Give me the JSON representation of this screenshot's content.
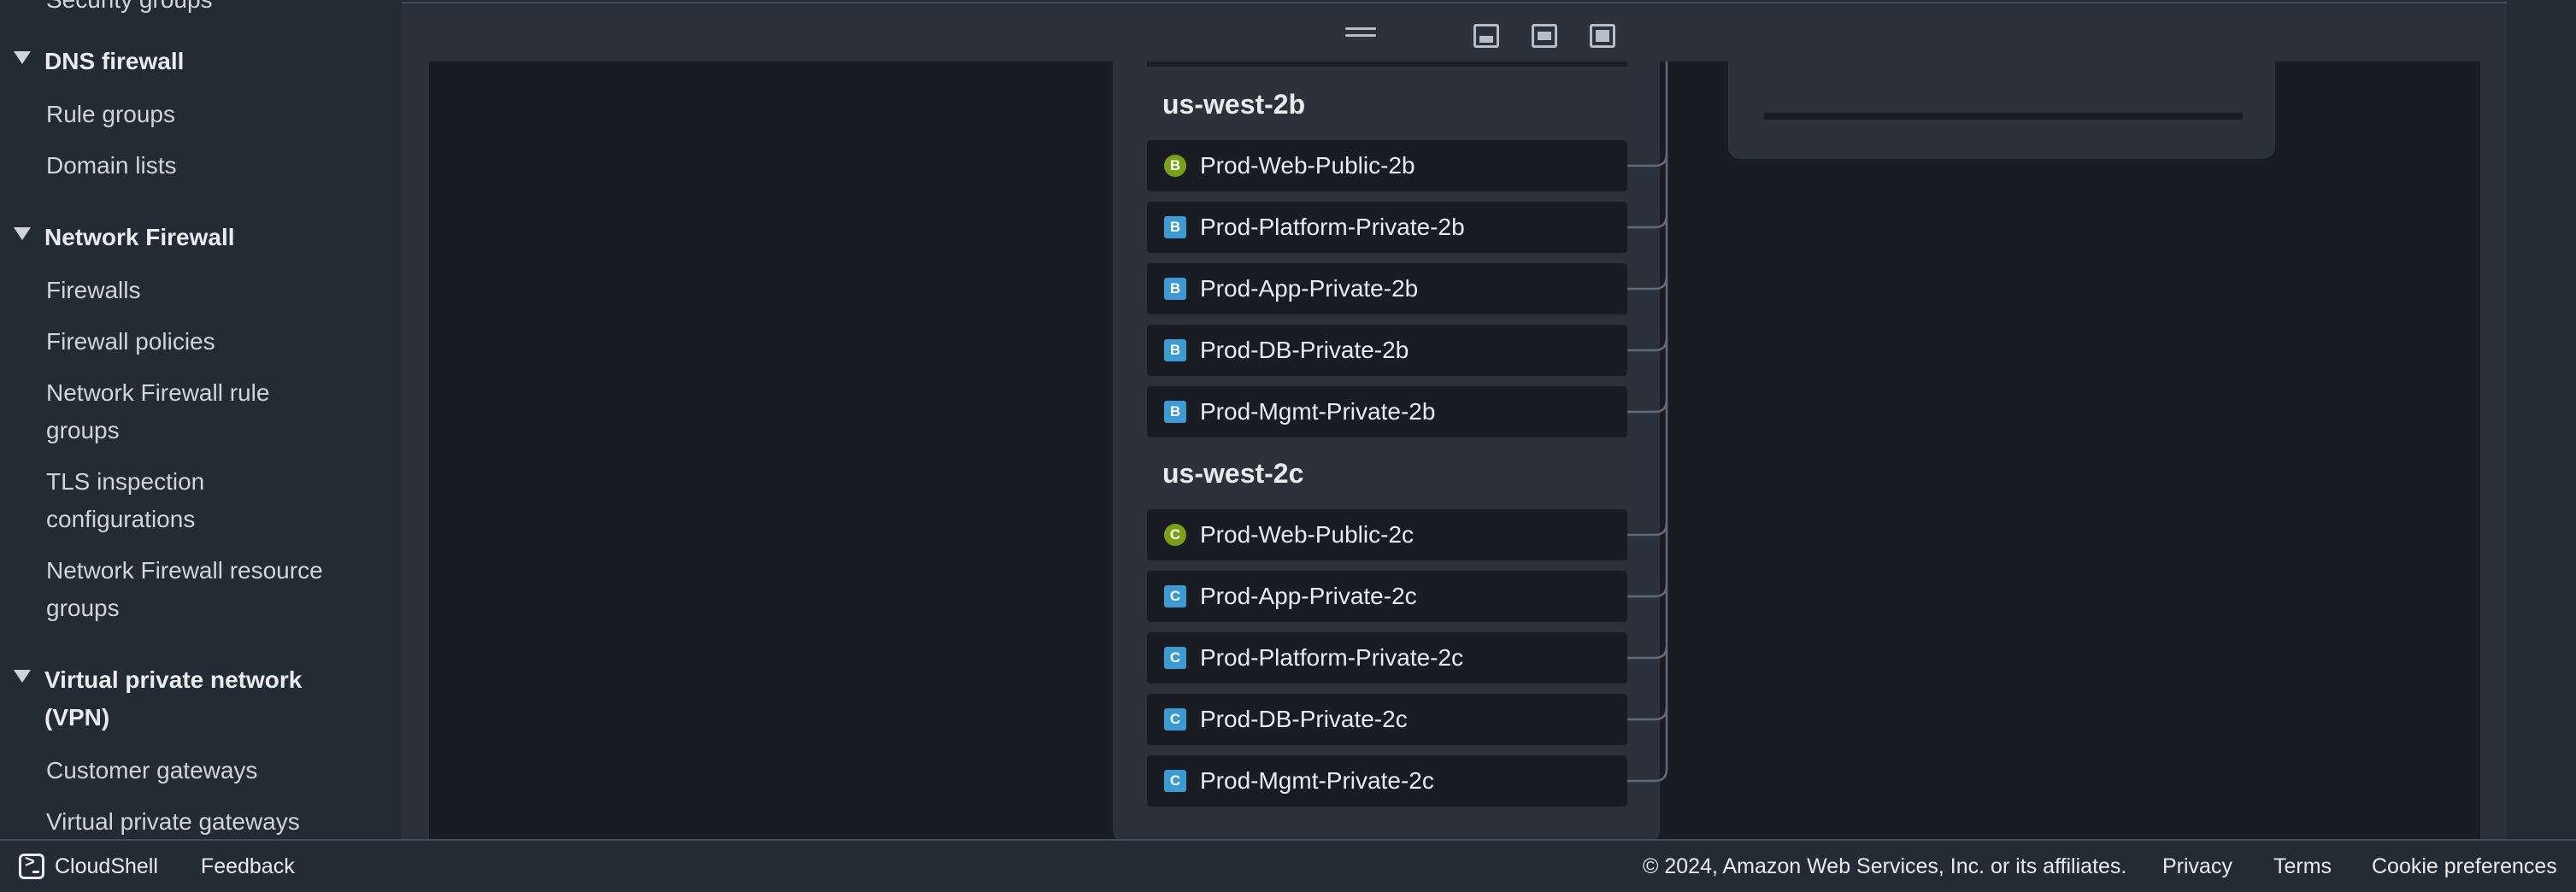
{
  "sidebar": {
    "clipped_item": "Security groups",
    "sections": [
      {
        "title": "DNS firewall",
        "items": [
          "Rule groups",
          "Domain lists"
        ]
      },
      {
        "title": "Network Firewall",
        "items": [
          "Firewalls",
          "Firewall policies",
          "Network Firewall rule groups",
          "TLS inspection configurations",
          "Network Firewall resource groups"
        ]
      },
      {
        "title": "Virtual private network (VPN)",
        "items": [
          "Customer gateways",
          "Virtual private gateways"
        ]
      }
    ]
  },
  "zones": [
    {
      "name": "us-west-2b",
      "subnets": [
        {
          "label": "Prod-Web-Public-2b",
          "badge": "B",
          "kind": "public"
        },
        {
          "label": "Prod-Platform-Private-2b",
          "badge": "B",
          "kind": "private"
        },
        {
          "label": "Prod-App-Private-2b",
          "badge": "B",
          "kind": "private"
        },
        {
          "label": "Prod-DB-Private-2b",
          "badge": "B",
          "kind": "private"
        },
        {
          "label": "Prod-Mgmt-Private-2b",
          "badge": "B",
          "kind": "private"
        }
      ]
    },
    {
      "name": "us-west-2c",
      "subnets": [
        {
          "label": "Prod-Web-Public-2c",
          "badge": "C",
          "kind": "public"
        },
        {
          "label": "Prod-App-Private-2c",
          "badge": "C",
          "kind": "private"
        },
        {
          "label": "Prod-Platform-Private-2c",
          "badge": "C",
          "kind": "private"
        },
        {
          "label": "Prod-DB-Private-2c",
          "badge": "C",
          "kind": "private"
        },
        {
          "label": "Prod-Mgmt-Private-2c",
          "badge": "C",
          "kind": "private"
        }
      ]
    }
  ],
  "colors": {
    "public_badge": "#7aa116",
    "private_badge": "#3b9ad1"
  },
  "footer": {
    "cloudshell": "CloudShell",
    "feedback": "Feedback",
    "copyright": "© 2024, Amazon Web Services, Inc. or its affiliates.",
    "privacy": "Privacy",
    "terms": "Terms",
    "cookies": "Cookie preferences"
  }
}
